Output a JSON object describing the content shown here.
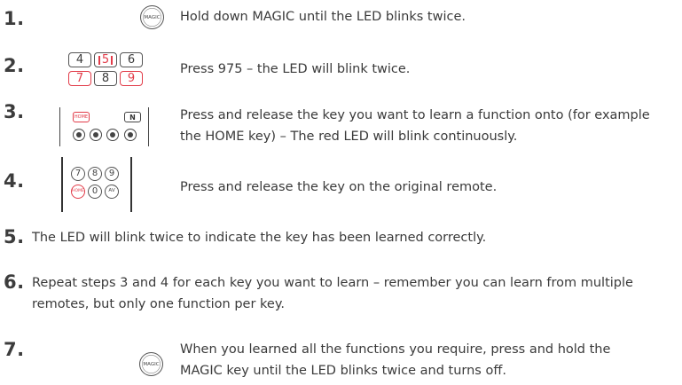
{
  "steps": [
    {
      "number": "1.",
      "text": "Hold down MAGIC until the LED blinks twice."
    },
    {
      "number": "2.",
      "text": "Press 975 – the LED will blink twice."
    },
    {
      "number": "3.",
      "line1": "Press and release the key you want to learn a function onto (for example",
      "line2": "the HOME key) – The red LED will blink continuously."
    },
    {
      "number": "4.",
      "text": "Press and release the key on the original remote."
    },
    {
      "number": "5.",
      "text": "The LED will blink twice to indicate the key has been learned correctly."
    },
    {
      "number": "6.",
      "line1": "Repeat steps 3 and 4 for each key you want to learn – remember you can learn from multiple",
      "line2": "remotes, but only one function per key."
    },
    {
      "number": "7.",
      "line1": "When you learned all the functions you require, press and hold the",
      "line2": "MAGIC key until the LED blinks twice and turns off."
    }
  ],
  "buttons": {
    "magic_label": "MAGIC",
    "home_label": "HOME",
    "n_label": "N",
    "av_label": "AV"
  },
  "keypad": {
    "row1": [
      "4",
      "5",
      "6"
    ],
    "row2": [
      "7",
      "8",
      "9"
    ]
  },
  "remote4": {
    "row1": [
      "7",
      "8",
      "9"
    ],
    "row2_mid": "0"
  },
  "colors": {
    "accent_red": "#e23c49",
    "text": "#3a3a3a"
  }
}
